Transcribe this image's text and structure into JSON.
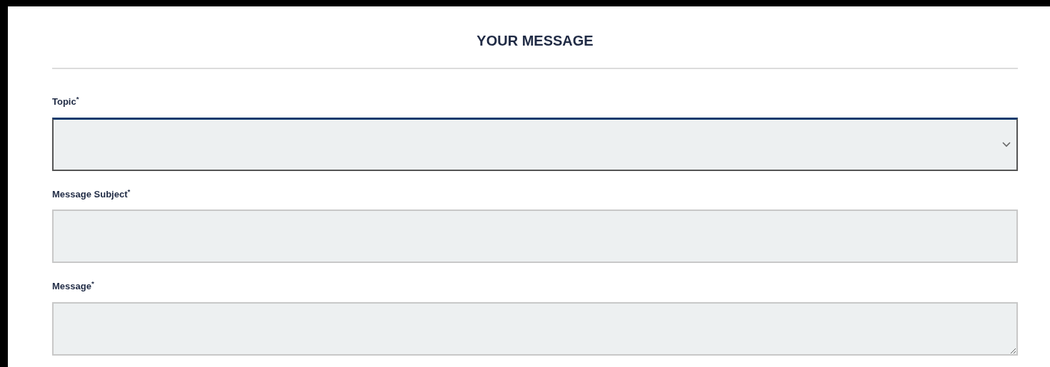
{
  "section": {
    "title": "YOUR MESSAGE"
  },
  "fields": [
    {
      "kind": "select",
      "label": "Topic$^{*}$",
      "focused": true
    },
    {
      "kind": "text",
      "label": "Message Subject$^{*}$",
      "focused": false
    },
    {
      "kind": "textarea",
      "label": "Message$^{*}$",
      "focused": false
    }
  ]
}
